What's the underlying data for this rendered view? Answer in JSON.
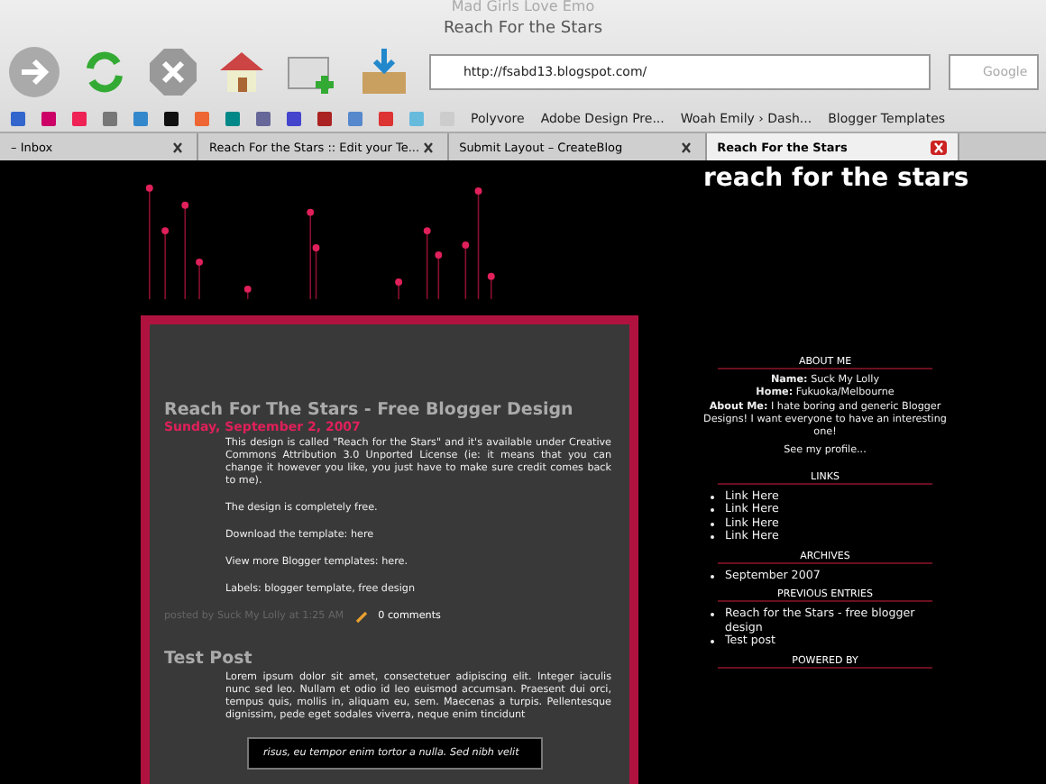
{
  "window": {
    "app_title": "Mad Girls Love Emo",
    "title": "Reach For the Stars"
  },
  "toolbar": {
    "url": "http://fsabd13.blogspot.com/",
    "search_placeholder": "Google"
  },
  "bookmarks": [
    "Polyvore",
    "Adobe Design Pre...",
    "Woah Emily › Dash...",
    "Blogger Templates"
  ],
  "tabs": [
    {
      "label": "– Inbox",
      "selected": false
    },
    {
      "label": "Reach For the Stars :: Edit your Te...",
      "selected": false
    },
    {
      "label": "Submit Layout – CreateBlog",
      "selected": false
    },
    {
      "label": "Reach For the Stars",
      "selected": true
    }
  ],
  "blog": {
    "title": "reach for the stars",
    "posts": [
      {
        "title": "Reach For The Stars - Free Blogger Design",
        "date": "Sunday, September 2, 2007",
        "paragraphs": [
          "This design is called \"Reach for the Stars\" and it's available under Creative Commons Attribution 3.0 Unported License (ie: it means that you can change it however you like, you just have to make sure credit comes back to me).",
          "The design is completely free.",
          "Download the template: here",
          "View more Blogger templates: here.",
          "Labels: blogger template, free design"
        ],
        "byline": "posted by Suck My Lolly at 1:25 AM",
        "comments": "0 comments"
      },
      {
        "title": "Test Post",
        "paragraphs": [
          "Lorem ipsum dolor sit amet, consectetuer adipiscing elit. Integer iaculis nunc sed leo. Nullam et odio id leo euismod accumsan. Praesent dui orci, tempus quis, mollis in, aliquam eu, sem. Maecenas a turpis. Pellentesque dignissim, pede eget sodales viverra, neque enim tincidunt"
        ],
        "quote": "risus, eu tempor enim tortor a nulla. Sed nibh velit"
      }
    ]
  },
  "sidebar": {
    "about": {
      "heading": "ABOUT ME",
      "fields": [
        {
          "label": "Name:",
          "value": "Suck My Lolly"
        },
        {
          "label": "Home:",
          "value": "Fukuoka/Melbourne"
        },
        {
          "label": "About Me:",
          "value": "I hate boring and generic Blogger Designs! I want everyone to have an interesting one!"
        }
      ],
      "profile_link": "See my profile..."
    },
    "sections": [
      {
        "heading": "LINKS",
        "items": [
          "Link Here",
          "Link Here",
          "Link Here",
          "Link Here"
        ]
      },
      {
        "heading": "ARCHIVES",
        "items": [
          "September 2007"
        ]
      },
      {
        "heading": "PREVIOUS ENTRIES",
        "items": [
          "Reach for the Stars - free blogger design",
          "Test post"
        ]
      },
      {
        "heading": "POWERED BY"
      }
    ]
  }
}
